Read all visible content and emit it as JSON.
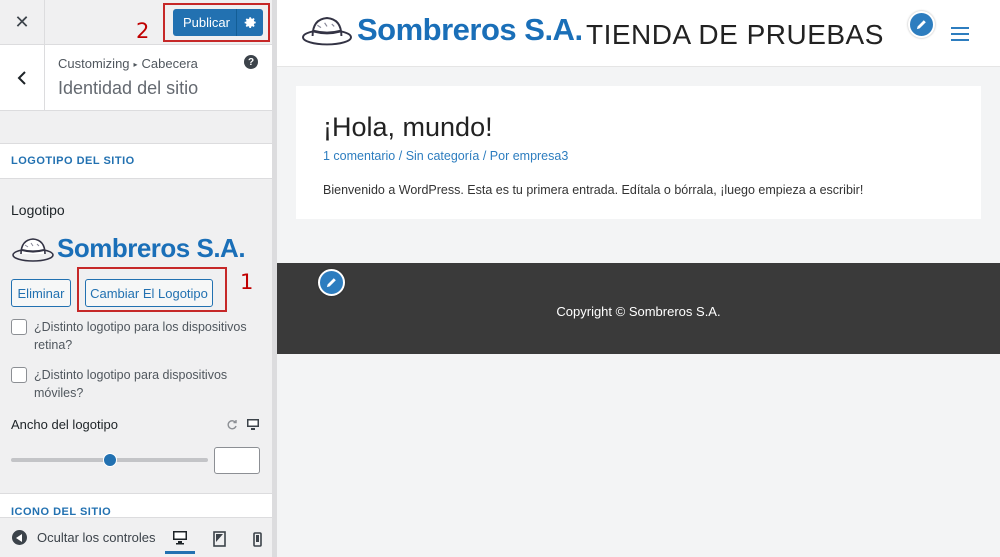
{
  "annotations": {
    "step1": "1",
    "step2": "2"
  },
  "header": {
    "publish_label": "Publicar"
  },
  "section": {
    "breadcrumb_root": "Customizing",
    "breadcrumb_parent": "Cabecera",
    "title": "Identidad del sitio"
  },
  "groups": {
    "logo_group": "Logotipo del sitio",
    "icon_group": "Icono del sitio"
  },
  "logo_control": {
    "label": "Logotipo",
    "logo_text": "Sombreros S.A.",
    "remove_label": "Eliminar",
    "change_label": "Cambiar El Logotipo",
    "retina_label": "¿Distinto logotipo para los dispositivos retina?",
    "mobile_label": "¿Distinto logotipo para dispositivos móviles?",
    "retina_checked": false,
    "mobile_checked": false
  },
  "width_control": {
    "label": "Ancho del logotipo",
    "slider_fraction": 0.5,
    "value": ""
  },
  "footer": {
    "collapse_label": "Ocultar los controles",
    "active_device": "desktop"
  },
  "preview": {
    "site_name": "Sombreros S.A.",
    "tagline": "TIENDA DE PRUEBAS",
    "post": {
      "title": "¡Hola, mundo!",
      "comments": "1 comentario",
      "sep1": " / ",
      "category": "Sin categoría",
      "sep2": " / Por ",
      "author": "empresa3",
      "excerpt": "Bienvenido a WordPress. Esta es tu primera entrada. Edítala o bórrala, ¡luego empieza a escribir!"
    },
    "copyright": "Copyright © Sombreros S.A."
  },
  "colors": {
    "accent": "#2271b1",
    "brand_blue": "#1a6fb8",
    "annotation_red": "#c62828",
    "footer_bg": "#3a3a3a"
  }
}
